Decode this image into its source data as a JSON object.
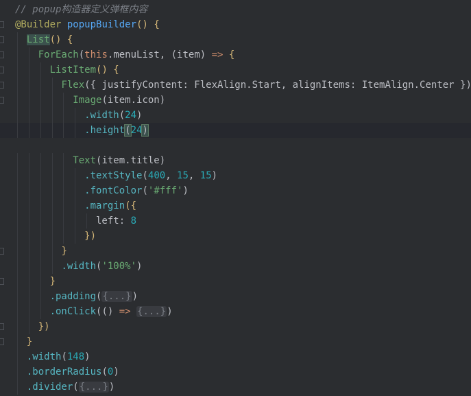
{
  "editor": {
    "lines": [
      [
        {
          "t": "// popup构造器定义弹框内容",
          "c": "comment"
        }
      ],
      [
        {
          "t": "@Builder",
          "c": "annot"
        },
        {
          "t": " ",
          "c": "plain"
        },
        {
          "t": "popupBuilder",
          "c": "fn"
        },
        {
          "t": "() {",
          "c": "brace"
        }
      ],
      [
        {
          "t": "  ",
          "c": "plain"
        },
        {
          "t": "List",
          "c": "list"
        },
        {
          "t": "() {",
          "c": "brace"
        }
      ],
      [
        {
          "t": "    ",
          "c": "plain"
        },
        {
          "t": "ForEach",
          "c": "type"
        },
        {
          "t": "(",
          "c": "paren"
        },
        {
          "t": "this",
          "c": "kw"
        },
        {
          "t": ".menuList, (item) ",
          "c": "plain"
        },
        {
          "t": "=>",
          "c": "kw"
        },
        {
          "t": " {",
          "c": "brace"
        }
      ],
      [
        {
          "t": "      ",
          "c": "plain"
        },
        {
          "t": "ListItem",
          "c": "type"
        },
        {
          "t": "() {",
          "c": "brace"
        }
      ],
      [
        {
          "t": "        ",
          "c": "plain"
        },
        {
          "t": "Flex",
          "c": "type"
        },
        {
          "t": "({ justifyContent: FlexAlign.Start, alignItems: ItemAlign.Center }) {",
          "c": "plain"
        }
      ],
      [
        {
          "t": "          ",
          "c": "plain"
        },
        {
          "t": "Image",
          "c": "type"
        },
        {
          "t": "(item.icon)",
          "c": "plain"
        }
      ],
      [
        {
          "t": "            ",
          "c": "plain"
        },
        {
          "t": ".width",
          "c": "method"
        },
        {
          "t": "(",
          "c": "paren"
        },
        {
          "t": "24",
          "c": "num"
        },
        {
          "t": ")",
          "c": "paren"
        }
      ],
      [
        {
          "t": "            ",
          "c": "plain"
        },
        {
          "t": ".height",
          "c": "method"
        },
        {
          "t": "(",
          "c": "match"
        },
        {
          "t": "24",
          "c": "num"
        },
        {
          "t": ")",
          "c": "match"
        }
      ],
      [],
      [
        {
          "t": "          ",
          "c": "plain"
        },
        {
          "t": "Text",
          "c": "type"
        },
        {
          "t": "(item.title)",
          "c": "plain"
        }
      ],
      [
        {
          "t": "            ",
          "c": "plain"
        },
        {
          "t": ".textStyle",
          "c": "method"
        },
        {
          "t": "(",
          "c": "paren"
        },
        {
          "t": "400",
          "c": "num"
        },
        {
          "t": ", ",
          "c": "plain"
        },
        {
          "t": "15",
          "c": "num"
        },
        {
          "t": ", ",
          "c": "plain"
        },
        {
          "t": "15",
          "c": "num"
        },
        {
          "t": ")",
          "c": "paren"
        }
      ],
      [
        {
          "t": "            ",
          "c": "plain"
        },
        {
          "t": ".fontColor",
          "c": "method"
        },
        {
          "t": "(",
          "c": "paren"
        },
        {
          "t": "'#fff'",
          "c": "str"
        },
        {
          "t": ")",
          "c": "paren"
        }
      ],
      [
        {
          "t": "            ",
          "c": "plain"
        },
        {
          "t": ".margin",
          "c": "method"
        },
        {
          "t": "({",
          "c": "brace"
        }
      ],
      [
        {
          "t": "              left: ",
          "c": "plain"
        },
        {
          "t": "8",
          "c": "num"
        }
      ],
      [
        {
          "t": "            ",
          "c": "plain"
        },
        {
          "t": "})",
          "c": "brace"
        }
      ],
      [
        {
          "t": "        ",
          "c": "plain"
        },
        {
          "t": "}",
          "c": "brace"
        }
      ],
      [
        {
          "t": "        ",
          "c": "plain"
        },
        {
          "t": ".width",
          "c": "method"
        },
        {
          "t": "(",
          "c": "paren"
        },
        {
          "t": "'100%'",
          "c": "str"
        },
        {
          "t": ")",
          "c": "paren"
        }
      ],
      [
        {
          "t": "      ",
          "c": "plain"
        },
        {
          "t": "}",
          "c": "brace"
        }
      ],
      [
        {
          "t": "      ",
          "c": "plain"
        },
        {
          "t": ".padding",
          "c": "method"
        },
        {
          "t": "(",
          "c": "paren"
        },
        {
          "t": "{...}",
          "c": "fold"
        },
        {
          "t": ")",
          "c": "paren"
        }
      ],
      [
        {
          "t": "      ",
          "c": "plain"
        },
        {
          "t": ".onClick",
          "c": "method"
        },
        {
          "t": "(() ",
          "c": "paren"
        },
        {
          "t": "=>",
          "c": "kw"
        },
        {
          "t": " ",
          "c": "plain"
        },
        {
          "t": "{...}",
          "c": "fold"
        },
        {
          "t": ")",
          "c": "paren"
        }
      ],
      [
        {
          "t": "    ",
          "c": "plain"
        },
        {
          "t": "})",
          "c": "brace"
        }
      ],
      [
        {
          "t": "  ",
          "c": "plain"
        },
        {
          "t": "}",
          "c": "brace"
        }
      ],
      [
        {
          "t": "  ",
          "c": "plain"
        },
        {
          "t": ".width",
          "c": "method"
        },
        {
          "t": "(",
          "c": "paren"
        },
        {
          "t": "148",
          "c": "num"
        },
        {
          "t": ")",
          "c": "paren"
        }
      ],
      [
        {
          "t": "  ",
          "c": "plain"
        },
        {
          "t": ".borderRadius",
          "c": "method"
        },
        {
          "t": "(",
          "c": "paren"
        },
        {
          "t": "0",
          "c": "num"
        },
        {
          "t": ")",
          "c": "paren"
        }
      ],
      [
        {
          "t": "  ",
          "c": "plain"
        },
        {
          "t": ".divider",
          "c": "method"
        },
        {
          "t": "(",
          "c": "paren"
        },
        {
          "t": "{...}",
          "c": "fold"
        },
        {
          "t": ")",
          "c": "paren"
        }
      ]
    ],
    "current_line": 8,
    "colors": {
      "background": "#2b2d30",
      "current_line": "#26282e",
      "comment": "#7a7e85",
      "annotation": "#b3ae60",
      "function": "#56a8f5",
      "component": "#6aab73",
      "keyword": "#cf8e6d",
      "method": "#56b6c2",
      "number": "#2aacb8",
      "string": "#6aab73",
      "brace": "#d5b778"
    }
  }
}
